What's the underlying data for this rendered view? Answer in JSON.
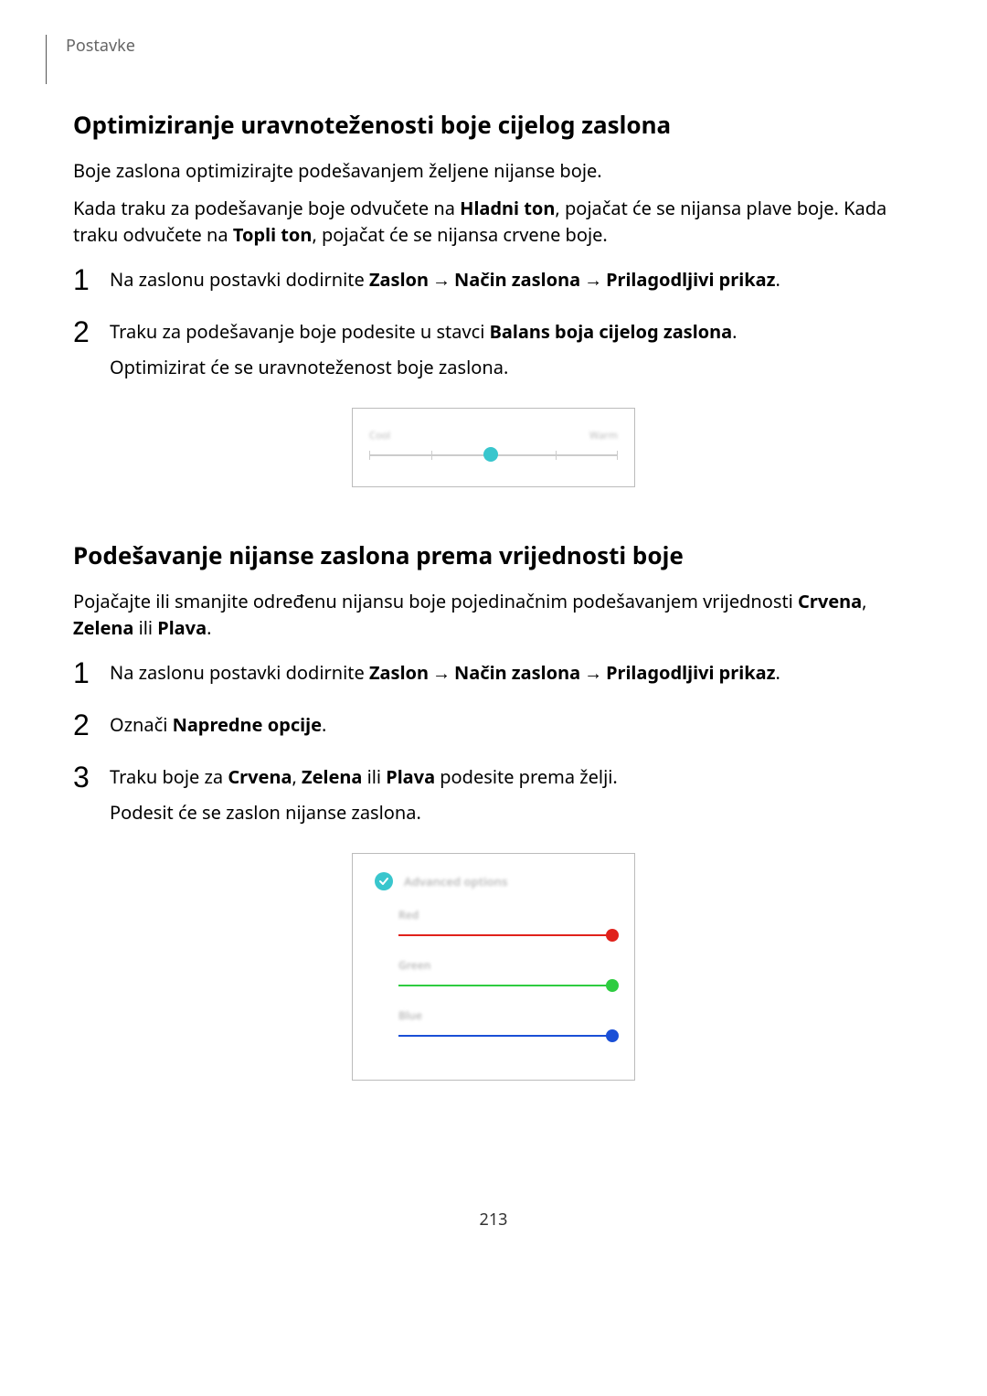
{
  "sectionLabel": "Postavke",
  "h1": "Optimiziranje uravnoteženosti boje cijelog zaslona",
  "p1": "Boje zaslona optimizirajte podešavanjem željene nijanse boje.",
  "p2_a": "Kada traku za podešavanje boje odvučete na ",
  "p2_b": "Hladni ton",
  "p2_c": ", pojačat će se nijansa plave boje. Kada traku odvučete na ",
  "p2_d": "Topli ton",
  "p2_e": ", pojačat će se nijansa crvene boje.",
  "s1_step1_a": "Na zaslonu postavki dodirnite ",
  "s1_step1_b": "Zaslon",
  "s1_step1_c": "Način zaslona",
  "s1_step1_d": "Prilagodljivi prikaz",
  "s1_step2_a": "Traku za podešavanje boje podesite u stavci ",
  "s1_step2_b": "Balans boja cijelog zaslona",
  "s1_step2_sub": "Optimizirat će se uravnoteženost boje zaslona.",
  "balance_left": "Cool",
  "balance_right": "Warm",
  "h2": "Podešavanje nijanse zaslona prema vrijednosti boje",
  "p3_a": "Pojačajte ili smanjite određenu nijansu boje pojedinačnim podešavanjem vrijednosti ",
  "p3_b": "Crvena",
  "p3_c": ", ",
  "p3_d": "Zelena",
  "p3_e": " ili ",
  "p3_f": "Plava",
  "p3_g": ".",
  "s2_step1_a": "Na zaslonu postavki dodirnite ",
  "s2_step1_b": "Zaslon",
  "s2_step1_c": "Način zaslona",
  "s2_step1_d": "Prilagodljivi prikaz",
  "s2_step2_a": "Označi ",
  "s2_step2_b": "Napredne opcije",
  "s2_step3_a": "Traku boje za ",
  "s2_step3_b": "Crvena",
  "s2_step3_c": ", ",
  "s2_step3_d": "Zelena",
  "s2_step3_e": " ili ",
  "s2_step3_f": "Plava",
  "s2_step3_g": " podesite prema želji.",
  "s2_step3_sub": "Podesit će se zaslon nijanse zaslona.",
  "adv_title": "Advanced options",
  "adv_red": "Red",
  "adv_green": "Green",
  "adv_blue": "Blue",
  "pageNumber": "213",
  "arrow": "→"
}
